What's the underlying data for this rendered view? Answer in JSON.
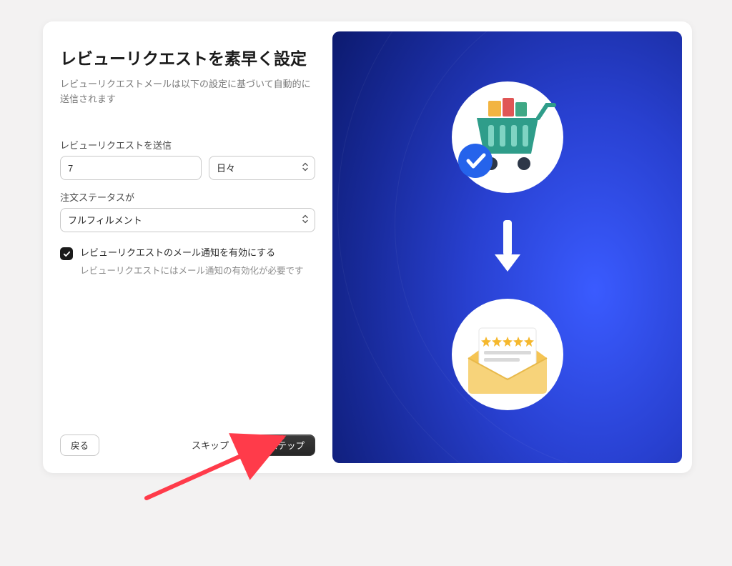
{
  "title": "レビューリクエストを素早く設定",
  "subtitle": "レビューリクエストメールは以下の設定に基づいて自動的に送信されます",
  "form": {
    "send_label": "レビューリクエストを送信",
    "days_value": "7",
    "unit_value": "日々",
    "status_label": "注文ステータスが",
    "status_value": "フルフィルメント"
  },
  "checkbox": {
    "checked": true,
    "label": "レビューリクエストのメール通知を有効にする",
    "help": "レビューリクエストにはメール通知の有効化が必要です"
  },
  "footer": {
    "back": "戻る",
    "skip": "スキップ",
    "next": "次のステップ"
  }
}
